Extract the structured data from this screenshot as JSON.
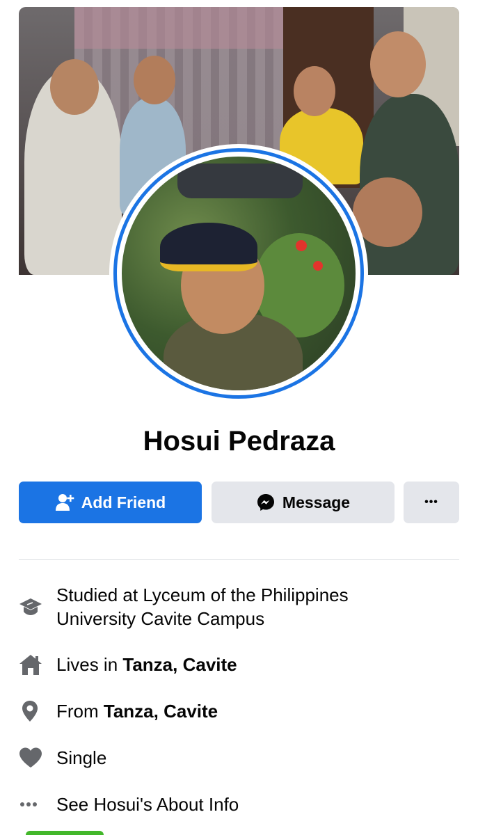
{
  "profile": {
    "name": "Hosui Pedraza"
  },
  "actions": {
    "add_friend": "Add Friend",
    "message": "Message",
    "more": "•••"
  },
  "info": {
    "education": "Studied at Lyceum of the Philippines University Cavite Campus",
    "lives_prefix": "Lives in ",
    "lives_place": "Tanza, Cavite",
    "from_prefix": "From ",
    "from_place": "Tanza, Cavite",
    "relationship": "Single",
    "about_link": "See Hosui's About Info"
  },
  "icons": {
    "education": "graduation-cap-icon",
    "home": "home-icon",
    "location": "map-pin-icon",
    "relationship": "heart-icon",
    "about": "more-dots-icon",
    "add_friend": "add-friend-icon",
    "message": "messenger-icon"
  },
  "colors": {
    "primary": "#1b74e4",
    "secondary_button": "#e4e6eb",
    "icon_gray": "#65676b",
    "text": "#050505"
  }
}
